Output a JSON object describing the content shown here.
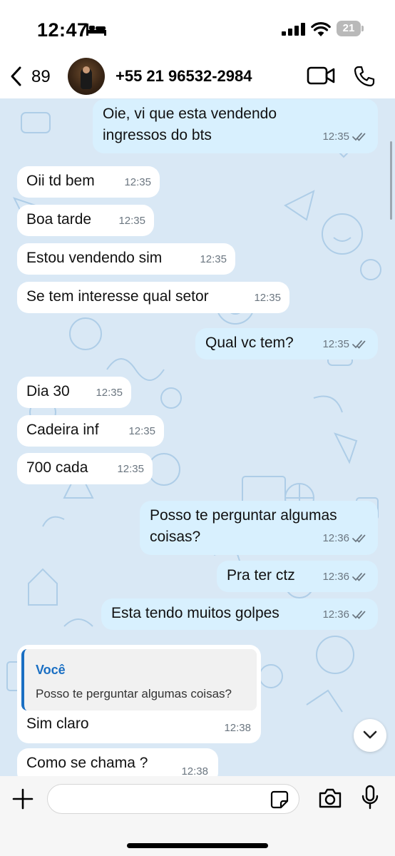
{
  "status_bar": {
    "time": "12:47",
    "battery": "21"
  },
  "header": {
    "back_count": "89",
    "contact": "+55 21 96532-2984"
  },
  "colors": {
    "outgoing_bubble": "#d8f0fe",
    "incoming_bubble": "#ffffff",
    "chat_background": "#d9e8f5",
    "quote_accent": "#1a6fc3"
  },
  "messages": [
    {
      "direction": "out",
      "lines": [
        "Oie, vi que esta vendendo",
        "ingressos do bts"
      ],
      "time": "12:35",
      "read": true
    },
    {
      "direction": "in",
      "text": "Oii td bem",
      "time": "12:35"
    },
    {
      "direction": "in",
      "text": "Boa tarde",
      "time": "12:35"
    },
    {
      "direction": "in",
      "text": "Estou vendendo sim",
      "time": "12:35"
    },
    {
      "direction": "in",
      "text": "Se tem interesse qual setor",
      "time": "12:35"
    },
    {
      "direction": "out",
      "text": "Qual vc tem?",
      "time": "12:35",
      "read": true
    },
    {
      "direction": "in",
      "text": "Dia 30",
      "time": "12:35"
    },
    {
      "direction": "in",
      "text": "Cadeira inf",
      "time": "12:35"
    },
    {
      "direction": "in",
      "text": "700 cada",
      "time": "12:35"
    },
    {
      "direction": "out",
      "lines": [
        "Posso te perguntar algumas",
        "coisas?"
      ],
      "time": "12:36",
      "read": true
    },
    {
      "direction": "out",
      "text": "Pra ter ctz",
      "time": "12:36",
      "read": true
    },
    {
      "direction": "out",
      "text": "Esta tendo muitos golpes",
      "time": "12:36",
      "read": true
    },
    {
      "direction": "in",
      "quote_author": "Você",
      "quote_text": "Posso te perguntar algumas coisas?",
      "text": "Sim claro",
      "time": "12:38"
    },
    {
      "direction": "in",
      "text": "Como se chama ?",
      "time": "12:38"
    }
  ],
  "icons": [
    "bed-icon",
    "signal-icon",
    "wifi-icon",
    "battery-icon",
    "back-chevron-icon",
    "video-call-icon",
    "phone-call-icon",
    "read-receipt-icon",
    "chevron-down-icon",
    "plus-icon",
    "sticker-icon",
    "camera-icon",
    "microphone-icon"
  ]
}
